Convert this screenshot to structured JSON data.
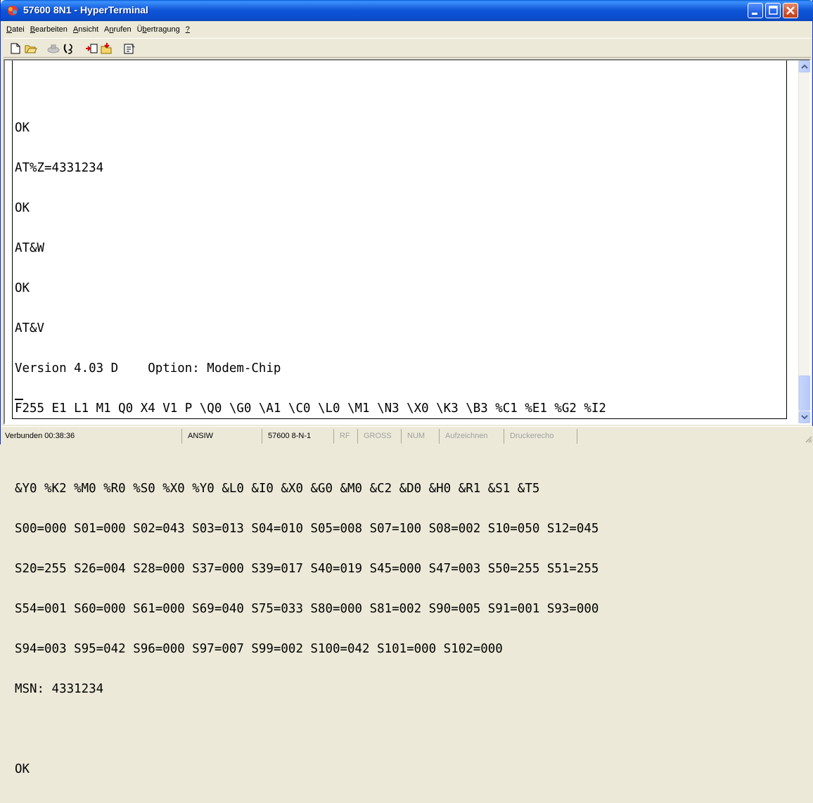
{
  "window": {
    "title": "57600 8N1 - HyperTerminal",
    "accent": "#0a4fd0"
  },
  "menu": {
    "items": [
      {
        "pre": "",
        "u": "D",
        "post": "atei"
      },
      {
        "pre": "",
        "u": "B",
        "post": "earbeiten"
      },
      {
        "pre": "",
        "u": "A",
        "post": "nsicht"
      },
      {
        "pre": "A",
        "u": "n",
        "post": "rufen"
      },
      {
        "pre": "Ü",
        "u": "b",
        "post": "ertragung"
      },
      {
        "pre": "",
        "u": "?",
        "post": ""
      }
    ]
  },
  "toolbar": {
    "icons": [
      "new-connection-icon",
      "open-icon",
      "disconnect-icon",
      "dial-icon",
      "send-icon",
      "receive-icon",
      "properties-icon"
    ]
  },
  "terminal": {
    "lines": [
      "OK",
      "AT%Z=4331234",
      "OK",
      "AT&W",
      "OK",
      "AT&V",
      "Version 4.03 D    Option: Modem-Chip",
      "F255 E1 L1 M1 Q0 X4 V1 P \\Q0 \\G0 \\A1 \\C0 \\L0 \\M1 \\N3 \\X0 \\K3 \\B3 %C1 %E1 %G2 %I2",
      "",
      "&Y0 %K2 %M0 %R0 %S0 %X0 %Y0 &L0 &I0 &X0 &G0 &M0 &C2 &D0 &H0 &R1 &S1 &T5",
      "S00=000 S01=000 S02=043 S03=013 S04=010 S05=008 S07=100 S08=002 S10=050 S12=045",
      "S20=255 S26=004 S28=000 S37=000 S39=017 S40=019 S45=000 S47=003 S50=255 S51=255",
      "S54=001 S60=000 S61=000 S69=040 S75=033 S80=000 S81=002 S90=005 S91=001 S93=000",
      "S94=003 S95=042 S96=000 S97=007 S99=002 S100=042 S101=000 S102=000",
      "MSN: 4331234",
      "",
      "OK"
    ]
  },
  "status": {
    "connected": "Verbunden 00:38:36",
    "emulation": "ANSIW",
    "settings": "57600 8-N-1",
    "rf": "RF",
    "gross": "GROSS",
    "num": "NUM",
    "record": "Aufzeichnen",
    "print_echo": "Druckerecho"
  }
}
